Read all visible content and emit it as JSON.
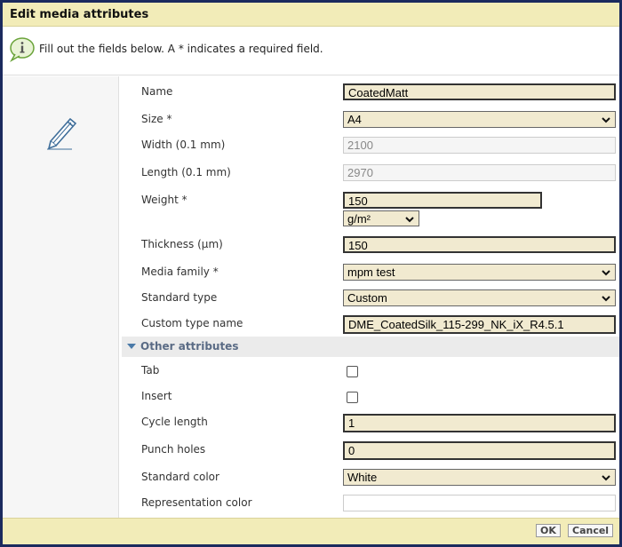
{
  "dialog": {
    "title": "Edit media attributes",
    "info_text": "Fill out the fields below. A * indicates a required field."
  },
  "fields": {
    "name": {
      "label": "Name",
      "value": "CoatedMatt"
    },
    "size": {
      "label": "Size *",
      "value": "A4"
    },
    "width": {
      "label": "Width (0.1 mm)",
      "value": "2100"
    },
    "length": {
      "label": "Length (0.1 mm)",
      "value": "2970"
    },
    "weight": {
      "label": "Weight *",
      "value": "150",
      "unit": "g/m²"
    },
    "thickness": {
      "label": "Thickness (µm)",
      "value": "150"
    },
    "media_family": {
      "label": "Media family *",
      "value": "mpm test"
    },
    "standard_type": {
      "label": "Standard type",
      "value": "Custom"
    },
    "custom_type_name": {
      "label": "Custom type name",
      "value": "DME_CoatedSilk_115-299_NK_iX_R4.5.1"
    }
  },
  "other": {
    "section_title": "Other attributes",
    "tab": {
      "label": "Tab",
      "checked": false
    },
    "insert": {
      "label": "Insert",
      "checked": false
    },
    "cycle_length": {
      "label": "Cycle length",
      "value": "1"
    },
    "punch_holes": {
      "label": "Punch holes",
      "value": "0"
    },
    "standard_color": {
      "label": "Standard color",
      "value": "White"
    },
    "representation_color": {
      "label": "Representation color",
      "value": ""
    }
  },
  "footer": {
    "ok_label": "OK",
    "cancel_label": "Cancel"
  },
  "colors": {
    "title_bar": "#f2ecb8",
    "field_bg": "#f1ead0",
    "window_border": "#1b2a5e"
  },
  "icons": {
    "info": "info-bubble-icon",
    "edit": "pencil-icon"
  }
}
